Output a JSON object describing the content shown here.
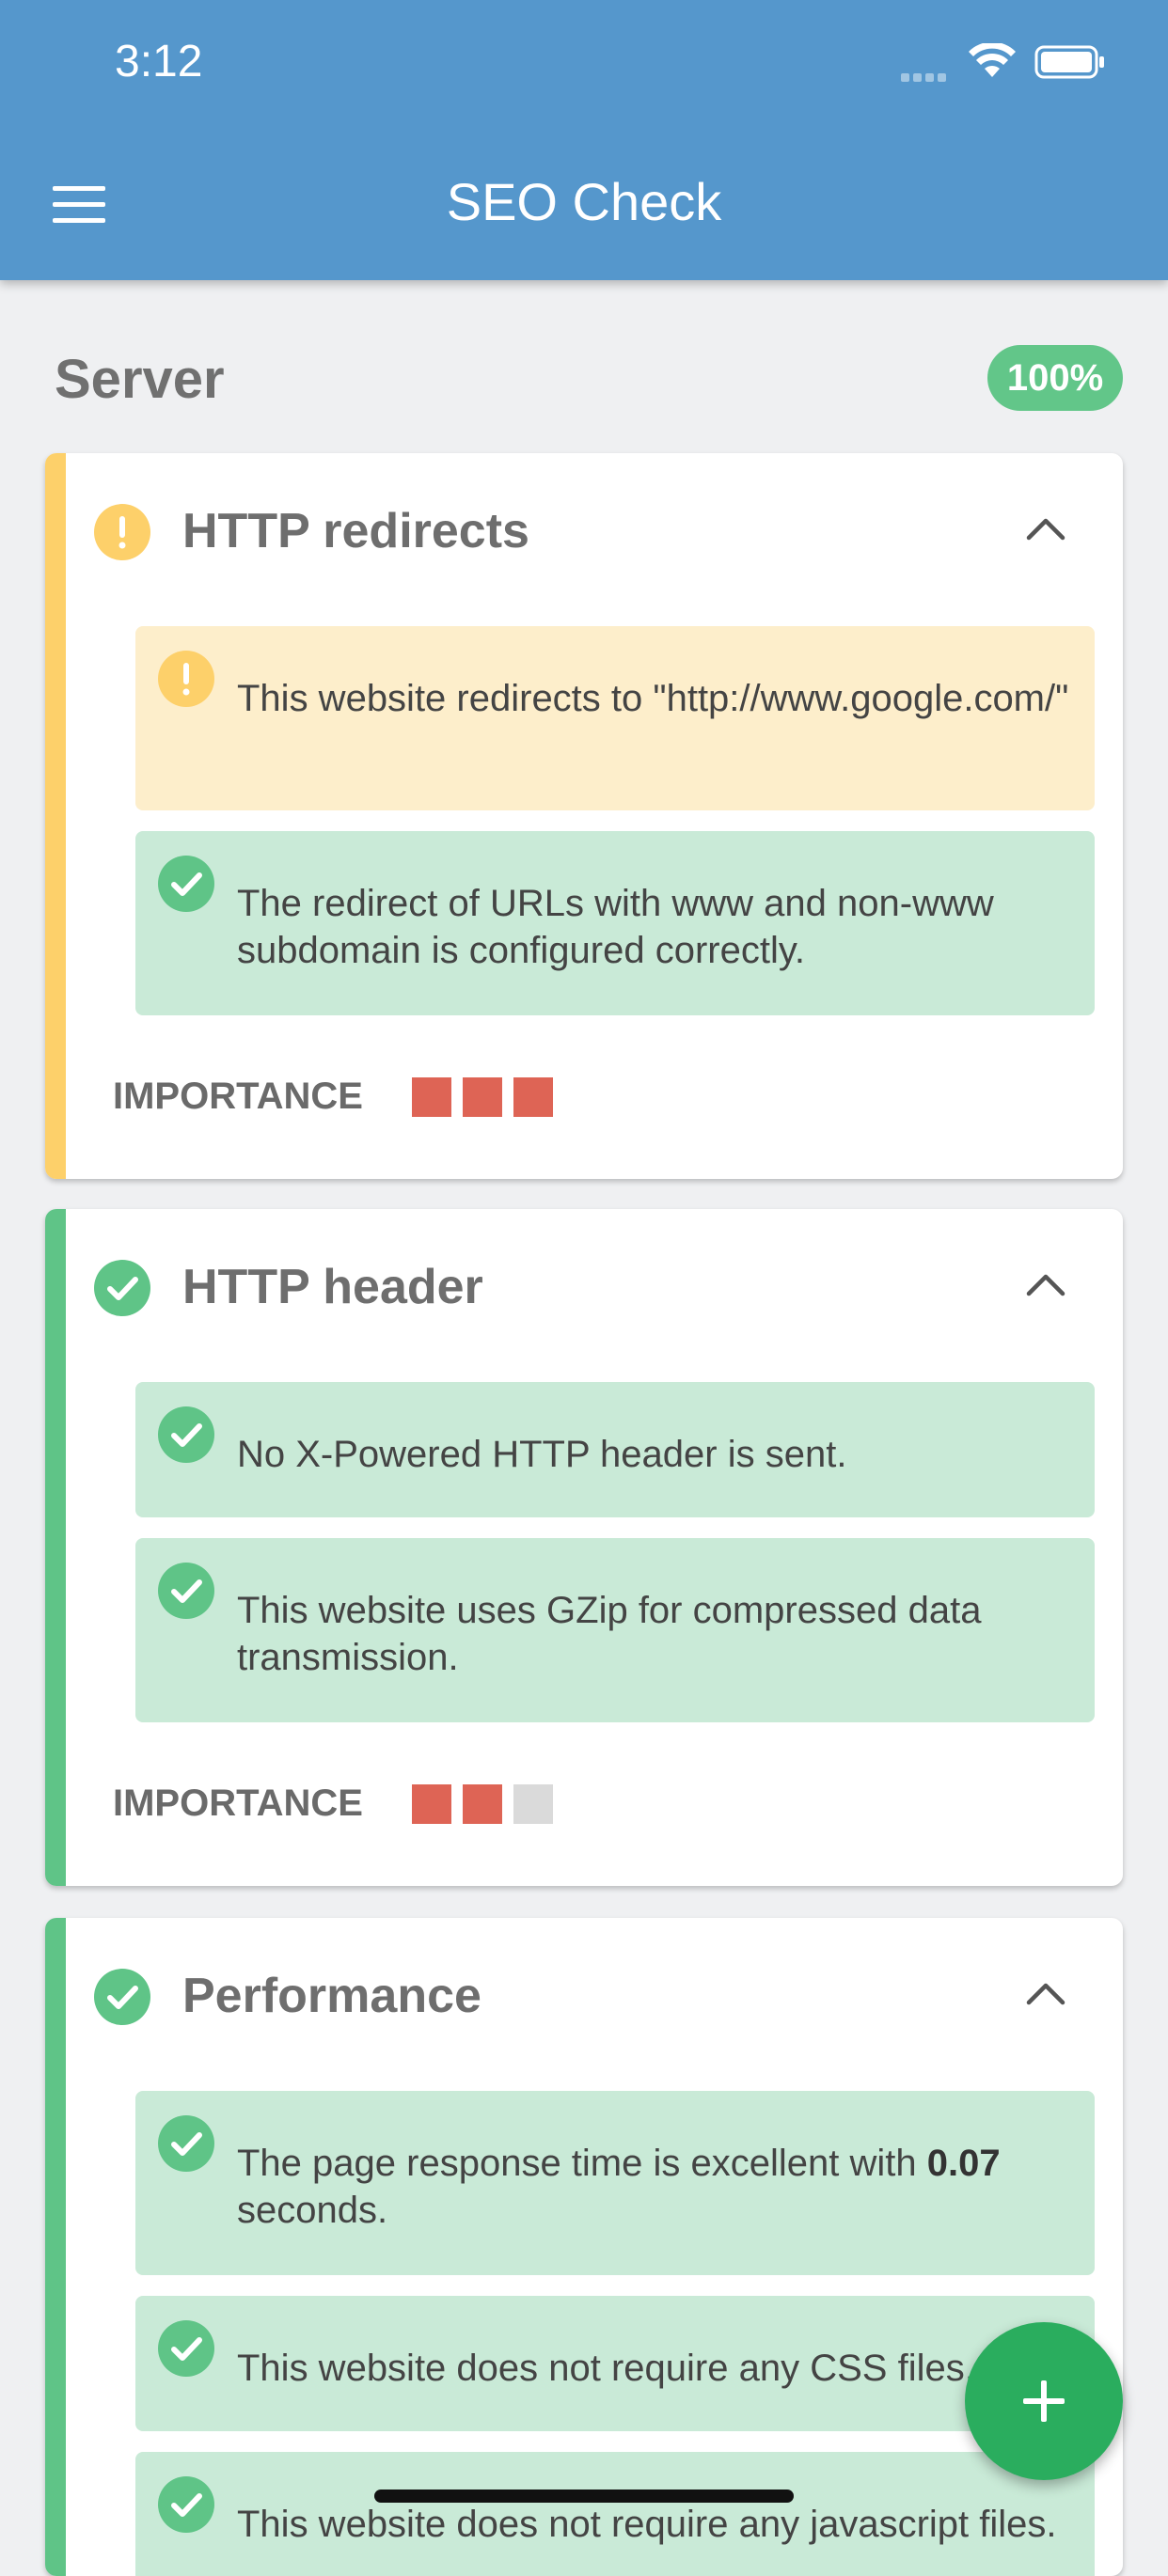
{
  "status_bar": {
    "time": "3:12"
  },
  "app_bar": {
    "title": "SEO Check"
  },
  "section": {
    "title": "Server",
    "score": "100%"
  },
  "colors": {
    "warning": "#fdd06a",
    "success": "#5fc487",
    "importance_on": "#de6455",
    "importance_off": "#dadada"
  },
  "cards": [
    {
      "title": "HTTP redirects",
      "status": "warning",
      "messages": [
        {
          "type": "warning",
          "text": "This website redirects to \"http://www.google.com/\""
        },
        {
          "type": "success",
          "text": "The redirect of URLs with www and non-www subdomain is configured correctly."
        }
      ],
      "importance_label": "IMPORTANCE",
      "importance": 3,
      "importance_max": 3
    },
    {
      "title": "HTTP header",
      "status": "success",
      "messages": [
        {
          "type": "success",
          "text": "No X-Powered HTTP header is sent."
        },
        {
          "type": "success",
          "text": "This website uses GZip for compressed data transmission."
        }
      ],
      "importance_label": "IMPORTANCE",
      "importance": 2,
      "importance_max": 3
    },
    {
      "title": "Performance",
      "status": "success",
      "messages": [
        {
          "type": "success",
          "text_before": "The page response time is excellent with ",
          "text_bold": "0.07",
          "text_after": " seconds."
        },
        {
          "type": "success",
          "text": "This website does not require any CSS files."
        },
        {
          "type": "success",
          "text": "This website does not require any javascript files."
        }
      ]
    }
  ]
}
